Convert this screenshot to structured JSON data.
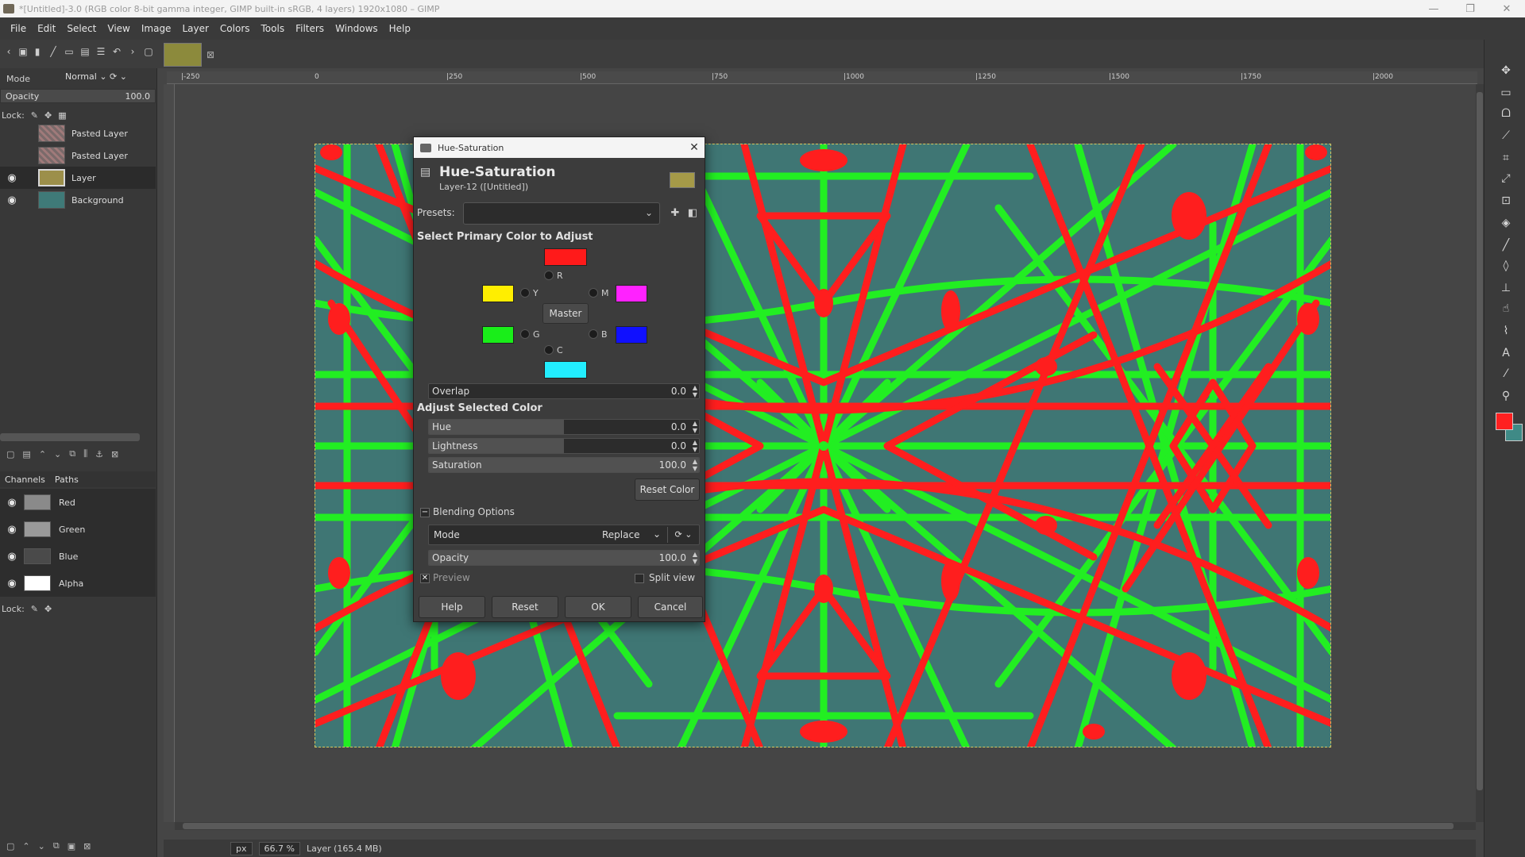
{
  "window": {
    "title": "*[Untitled]-3.0 (RGB color 8-bit gamma integer, GIMP built-in sRGB, 4 layers) 1920x1080 – GIMP",
    "minimize": "—",
    "maximize": "❐",
    "close": "✕"
  },
  "menubar": [
    "File",
    "Edit",
    "Select",
    "View",
    "Image",
    "Layer",
    "Colors",
    "Tools",
    "Filters",
    "Windows",
    "Help"
  ],
  "layers_panel": {
    "mode_label": "Mode",
    "mode_value": "Normal",
    "opacity_label": "Opacity",
    "opacity_value": "100.0",
    "lock_label": "Lock:",
    "layers": [
      {
        "name": "Pasted Layer",
        "visible": false
      },
      {
        "name": "Pasted Layer",
        "visible": false
      },
      {
        "name": "Layer",
        "visible": true
      },
      {
        "name": "Background",
        "visible": true
      }
    ]
  },
  "channels_panel": {
    "tab_channels": "Channels",
    "tab_paths": "Paths",
    "channels": [
      {
        "name": "Red"
      },
      {
        "name": "Green"
      },
      {
        "name": "Blue"
      },
      {
        "name": "Alpha"
      }
    ],
    "lock_label": "Lock:"
  },
  "ruler": {
    "h_ticks": [
      "|-250",
      "0",
      "|250",
      "|500",
      "|750",
      "|1000",
      "|1250",
      "|1500",
      "|1750",
      "|2000"
    ]
  },
  "statusbar": {
    "unit": "px",
    "zoom": "66.7 %",
    "info": "Layer (165.4 MB)"
  },
  "dialog": {
    "window_title": "Hue-Saturation",
    "close": "✕",
    "heading": "Hue-Saturation",
    "subheading": "Layer-12 ([Untitled])",
    "presets_label": "Presets:",
    "section_primary": "Select Primary Color to Adjust",
    "master_label": "Master",
    "primaries": [
      {
        "key": "R",
        "color": "#ff1a1a"
      },
      {
        "key": "Y",
        "color": "#ffee00"
      },
      {
        "key": "M",
        "color": "#ff22ff"
      },
      {
        "key": "G",
        "color": "#19ee19"
      },
      {
        "key": "B",
        "color": "#1010ff"
      },
      {
        "key": "C",
        "color": "#22eeff"
      }
    ],
    "overlap": {
      "label": "Overlap",
      "value": "0.0",
      "fraction": 0.0
    },
    "section_adjust": "Adjust Selected Color",
    "hue": {
      "label": "Hue",
      "value": "0.0",
      "fraction": 0.5
    },
    "lightness": {
      "label": "Lightness",
      "value": "0.0",
      "fraction": 0.5
    },
    "saturation": {
      "label": "Saturation",
      "value": "100.0",
      "fraction": 1.0
    },
    "reset_color": "Reset Color",
    "blending_label": "Blending Options",
    "mode": {
      "label": "Mode",
      "value": "Replace"
    },
    "opacity": {
      "label": "Opacity",
      "value": "100.0",
      "fraction": 1.0
    },
    "preview_label": "Preview",
    "split_view_label": "Split view",
    "buttons": {
      "help": "Help",
      "reset": "Reset",
      "ok": "OK",
      "cancel": "Cancel"
    }
  }
}
